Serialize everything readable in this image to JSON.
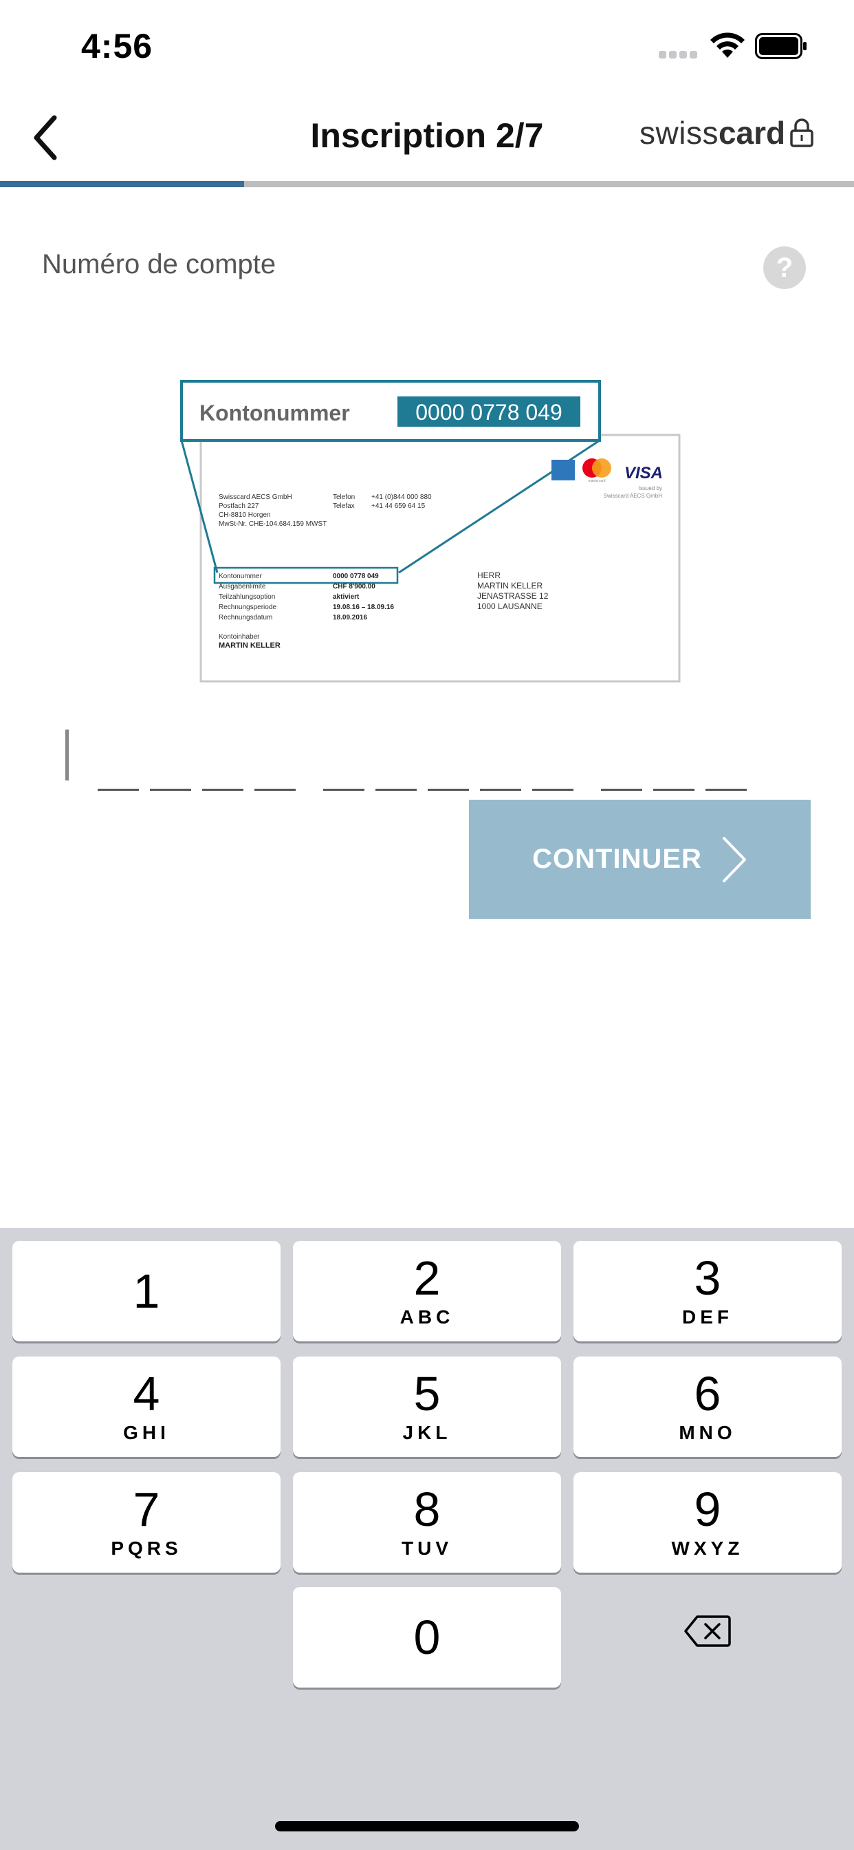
{
  "status_bar": {
    "time": "4:56"
  },
  "nav": {
    "title": "Inscription 2/7",
    "brand_light": "swiss",
    "brand_bold": "card"
  },
  "progress": {
    "fraction": 0.2857
  },
  "form": {
    "label": "Numéro de compte",
    "help": "?",
    "continue_label": "CONTINUER",
    "slot_groups": [
      4,
      5,
      3
    ]
  },
  "card": {
    "zoom_label": "Kontonummer",
    "zoom_value": "0000 0778 049",
    "sender": [
      "Swisscard AECS GmbH",
      "Postfach 227",
      "CH-8810 Horgen",
      "MwSt-Nr. CHE-104.684.159 MWST"
    ],
    "contact_labels": [
      "Telefon",
      "Telefax"
    ],
    "contact_values": [
      "+41 (0)844 000 880",
      "+41 44 659 64 15"
    ],
    "details_labels": [
      "Kontonummer",
      "Ausgabenlimite",
      "Teilzahlungsoption",
      "Rechnungsperiode",
      "Rechnungsdatum"
    ],
    "details_values": [
      "0000 0778 049",
      "CHF 8'900.00",
      "aktiviert",
      "19.08.16 – 18.09.16",
      "18.09.2016"
    ],
    "holder_label": "Kontoinhaber",
    "holder_name": "MARTIN KELLER",
    "address": [
      "HERR",
      "MARTIN KELLER",
      "JENASTRASSE 12",
      "1000 LAUSANNE"
    ],
    "visa": "VISA",
    "mastercard": "mastercard",
    "issued_by": [
      "Issued by",
      "Swisscard AECS GmbH"
    ]
  },
  "keyboard": {
    "keys": [
      {
        "digit": "1",
        "letters": ""
      },
      {
        "digit": "2",
        "letters": "ABC"
      },
      {
        "digit": "3",
        "letters": "DEF"
      },
      {
        "digit": "4",
        "letters": "GHI"
      },
      {
        "digit": "5",
        "letters": "JKL"
      },
      {
        "digit": "6",
        "letters": "MNO"
      },
      {
        "digit": "7",
        "letters": "PQRS"
      },
      {
        "digit": "8",
        "letters": "TUV"
      },
      {
        "digit": "9",
        "letters": "WXYZ"
      },
      {
        "digit": "0",
        "letters": ""
      }
    ]
  },
  "colors": {
    "accent": "#3a6e96",
    "card_teal": "#1f7a93",
    "continue_disabled": "#97bacd",
    "keyboard_bg": "#d1d3d9"
  }
}
